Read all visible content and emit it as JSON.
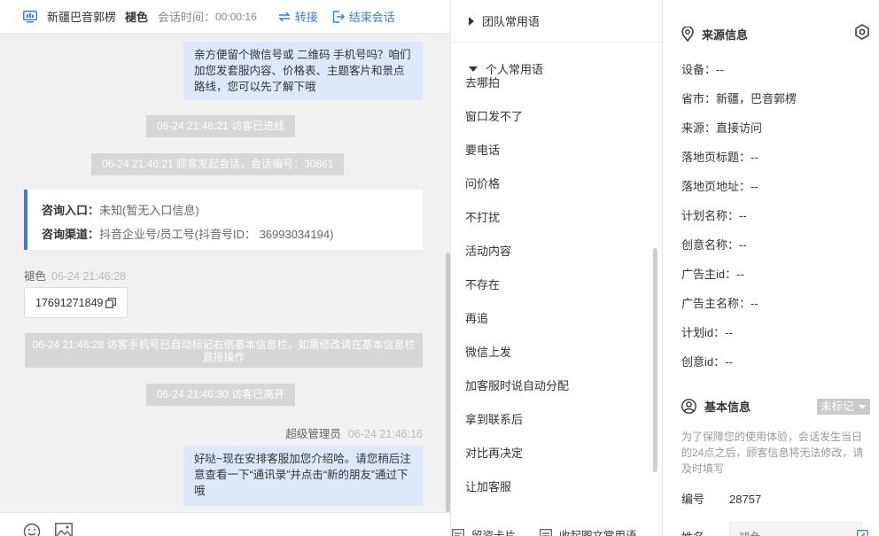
{
  "header": {
    "location": "新疆巴音郭楞",
    "visitor_name": "褪色",
    "time_label": "会话时间：",
    "time_value": "00:00:16",
    "transfer_label": "转接",
    "end_label": "结束会话"
  },
  "messages": {
    "top_bubble": "亲方便留个微信号或 二维码 手机号吗？咱们加您发套服内容、价格表、主题客片和景点路线，您可以先了解下哦",
    "sys_entered": "06-24 21:46:21 访客已进线",
    "sys_started": "06-24 21:46:21 顾客发起会话，会话编号：30861",
    "info_card": {
      "entry_label": "咨询入口：",
      "entry_value": "未知(暂无入口信息)",
      "channel_label": "咨询渠道：",
      "channel_value": "抖音企业号/员工号(抖音号ID： 36993034194)"
    },
    "visitor_sender": "褪色",
    "visitor_time": "06-24 21:46:28",
    "visitor_phone": "17691271849",
    "sys_marked": "06-24 21:46:28 访客手机号已自动标记右侧基本信息栏，如需修改请在基本信息栏直接操作",
    "sys_left": "06-24 21:46:30 访客已离开",
    "admin_sender": "超级管理员",
    "admin_time": "06-24 21:46:16",
    "admin_bubble": "好哒~现在安排客服加您介绍哈。请您稍后注意查看一下“通讯录”并点击“新的朋友”通过下哦"
  },
  "phrases": {
    "team_group": "团队常用语",
    "personal_group": "个人常用语",
    "items": [
      "去哪拍",
      "窗口发不了",
      "要电话",
      "问价格",
      "不打扰",
      "活动内容",
      "不存在",
      "再追",
      "微信上发",
      "加客服时说自动分配",
      "拿到联系后",
      "对比再决定",
      "让加客服"
    ],
    "footer_left": "留资卡片",
    "footer_right": "收起图文常用语"
  },
  "info": {
    "source_title": "来源信息",
    "source_fields": [
      "设备：--",
      "省市：新疆，巴音郭楞",
      "来源：直接访问",
      "落地页标题：--",
      "落地页地址：--",
      "计划名称：--",
      "创意名称：--",
      "广告主id：--",
      "广告主名称：--",
      "计划id：--",
      "创意id：--"
    ],
    "basic_title": "基本信息",
    "badge": "未标记",
    "notice": "为了保障您的使用体验，会话发生当日的24点之后，顾客信息将无法修改，请及时填写",
    "id_label": "编号",
    "id_value": "28757",
    "name_label": "姓名",
    "name_value": "褪色"
  },
  "colors": {
    "accent": "#3a7be0",
    "bubble": "#dde8fb",
    "system_message": "#d6d6d6",
    "chat_background": "#f1f1f1"
  },
  "icons": [
    "monitor-icon",
    "transfer-icon",
    "exit-icon",
    "triangle-right-icon",
    "triangle-down-icon",
    "copy-icon",
    "emoji-icon",
    "image-icon",
    "card-icon",
    "collapse-icon",
    "location-icon",
    "settings-icon",
    "user-icon",
    "edit-icon"
  ]
}
